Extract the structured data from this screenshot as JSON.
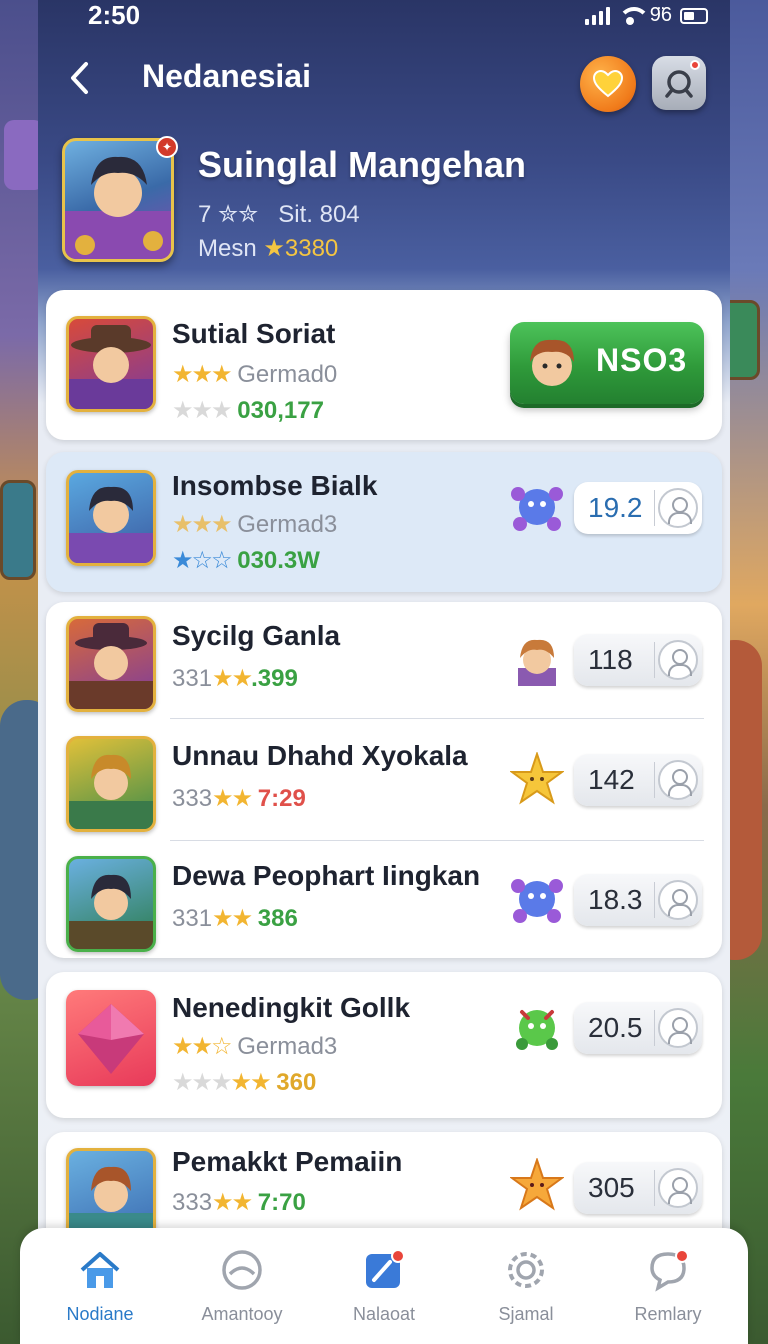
{
  "status_bar": {
    "time": "2:50",
    "battery_text": "9̈6"
  },
  "header": {
    "title": "Nedanesiai"
  },
  "profile": {
    "name": "Suinglal Mangehan",
    "line2_prefix": "7",
    "line2_stars": "✮✮",
    "line2_text": "Sit. 804",
    "line3_prefix": "Mesn",
    "line3_value": "★3380"
  },
  "cards": {
    "featured": {
      "title": "Sutial Soriat",
      "sub1_stars": "★★★",
      "sub1_text": "Germad0",
      "sub2_stars": "★★★",
      "sub2_value": "030,177",
      "button_label": "NSO3"
    },
    "highlight": {
      "title": "Insombse Bialk",
      "sub1_stars": "★★★",
      "sub1_text": "Germad3",
      "sub2_stars": "★☆☆",
      "sub2_value": "030.3W",
      "score": "19.2"
    },
    "list": [
      {
        "title": "Sycilg Ganla",
        "prefix": "331",
        "stars": "★★",
        "value": ".399",
        "score": "118"
      },
      {
        "title": "Unnau Dhahd Xyokala",
        "prefix": "333",
        "stars": "★★",
        "value": "7:29",
        "score": "142"
      },
      {
        "title": "Dewa Peophart Iingkan",
        "prefix": "331",
        "stars": "★★",
        "value": "386",
        "score": "18.3"
      }
    ],
    "gem": {
      "title": "Nenedingkit Gollk",
      "sub1_stars": "★★☆",
      "sub1_text": "Germad3",
      "sub2_dim_stars": "★★★",
      "sub2_stars": "★★",
      "sub2_value": "360",
      "score": "20.5"
    },
    "last": {
      "title": "Pemakkt Pemaiin",
      "prefix": "333",
      "stars": "★★",
      "value": "7:70",
      "score": "305"
    }
  },
  "bottom_nav": [
    {
      "label": "Nodiane",
      "icon": "home-icon",
      "active": true
    },
    {
      "label": "Amantooy",
      "icon": "helmet-icon",
      "active": false
    },
    {
      "label": "Nalaoat",
      "icon": "edit-icon",
      "active": false
    },
    {
      "label": "Sjamal",
      "icon": "gear-icon",
      "active": false
    },
    {
      "label": "Remlary",
      "icon": "chat-icon",
      "active": false
    }
  ],
  "colors": {
    "accent": "#2a7ac8",
    "green_button": "#2f9a3a",
    "header_bg": "#2a3566"
  }
}
